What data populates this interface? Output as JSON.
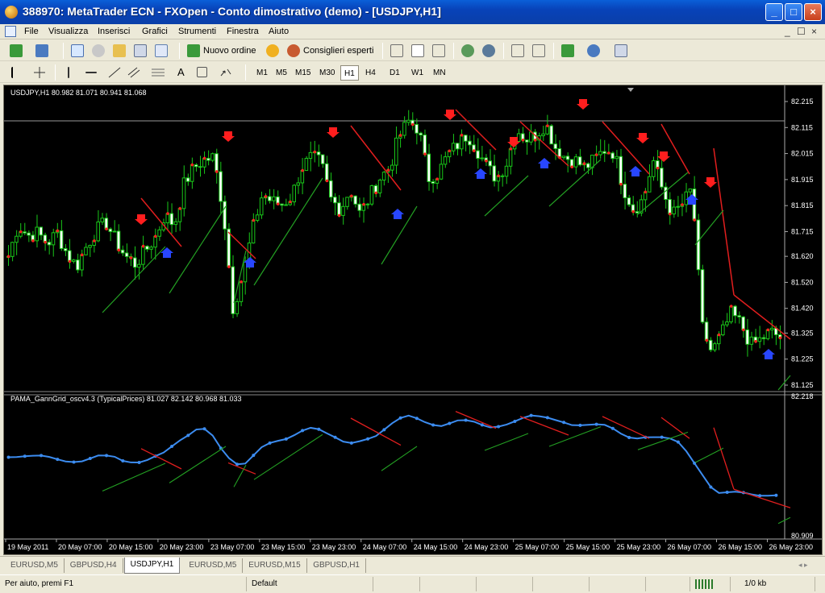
{
  "window": {
    "title": "388970: MetaTrader ECN - FXOpen - Conto dimostrativo (demo) - [USDJPY,H1]",
    "controls": [
      "_",
      "□",
      "×"
    ]
  },
  "menu": {
    "items": [
      "File",
      "Visualizza",
      "Inserisci",
      "Grafici",
      "Strumenti",
      "Finestra",
      "Aiuto"
    ],
    "mdi_controls": [
      "_",
      "☐",
      "×"
    ]
  },
  "toolbar1": {
    "new_order_label": "Nuovo ordine",
    "expert_advisors_label": "Consiglieri esperti"
  },
  "toolbar2": {
    "text_tool": "A",
    "timeframes": [
      "M1",
      "M5",
      "M15",
      "M30",
      "H1",
      "H4",
      "D1",
      "W1",
      "MN"
    ],
    "active_timeframe": "H1"
  },
  "chart": {
    "header": "USDJPY,H1  80.982 81.071 80.941 81.068",
    "indicator_header": "PAMA_GannGrid_oscv4.3  (TypicalPrices)  81.027 82.142 80.968 81.033",
    "price_ticks": [
      "82.215",
      "82.115",
      "82.015",
      "81.915",
      "81.815",
      "81.715",
      "81.620",
      "81.520",
      "81.420",
      "81.325",
      "81.225",
      "81.125"
    ],
    "indicator_ticks": [
      "82.218",
      "80.909"
    ],
    "time_ticks": [
      "19 May 2011",
      "20 May 07:00",
      "20 May 15:00",
      "20 May 23:00",
      "23 May 07:00",
      "23 May 15:00",
      "23 May 23:00",
      "24 May 07:00",
      "24 May 15:00",
      "24 May 23:00",
      "25 May 07:00",
      "25 May 15:00",
      "25 May 23:00",
      "26 May 07:00",
      "26 May 15:00",
      "26 May 23:00"
    ],
    "colors": {
      "background": "#000000",
      "candles": "#19c819",
      "indicator_line": "#3c8cf0",
      "down_arrow": "#ff1e1e",
      "up_arrow": "#2846ff",
      "trend_down": "#e11e1e",
      "trend_up": "#23a023",
      "axis_text": "#ffffff"
    }
  },
  "chart_data": {
    "type": "candlestick",
    "symbol": "USDJPY",
    "timeframe": "H1",
    "ylim": [
      81.125,
      82.215
    ],
    "indicator_ylim": [
      80.909,
      82.218
    ],
    "x": [
      "19 May 2011",
      "20 May 07:00",
      "20 May 15:00",
      "20 May 23:00",
      "23 May 07:00",
      "23 May 15:00",
      "23 May 23:00",
      "24 May 07:00",
      "24 May 15:00",
      "24 May 23:00",
      "25 May 07:00",
      "25 May 15:00",
      "25 May 23:00",
      "26 May 07:00",
      "26 May 15:00",
      "26 May 23:00"
    ],
    "close_path": [
      81.62,
      81.74,
      81.7,
      81.71,
      81.67,
      81.71,
      81.63,
      81.58,
      81.66,
      81.72,
      81.75,
      81.68,
      81.62,
      81.59,
      81.64,
      81.69,
      81.78,
      81.74,
      81.9,
      81.96,
      81.99,
      82.0,
      81.8,
      81.42,
      81.55,
      81.72,
      81.86,
      81.83,
      81.82,
      81.85,
      81.96,
      82.0,
      81.98,
      81.84,
      81.8,
      81.88,
      81.78,
      81.85,
      81.92,
      81.96,
      82.08,
      82.14,
      82.11,
      81.92,
      81.94,
      82.01,
      82.05,
      82.09,
      82.03,
      81.96,
      81.92,
      81.98,
      82.11,
      82.07,
      82.09,
      82.13,
      82.04,
      82.0,
      81.99,
      81.96,
      81.99,
      82.03,
      82.02,
      81.88,
      81.8,
      81.84,
      81.99,
      81.87,
      81.78,
      81.82,
      81.88,
      81.35,
      81.25,
      81.32,
      81.4,
      81.36,
      81.28,
      81.3,
      81.33,
      81.31
    ]
  }
}
